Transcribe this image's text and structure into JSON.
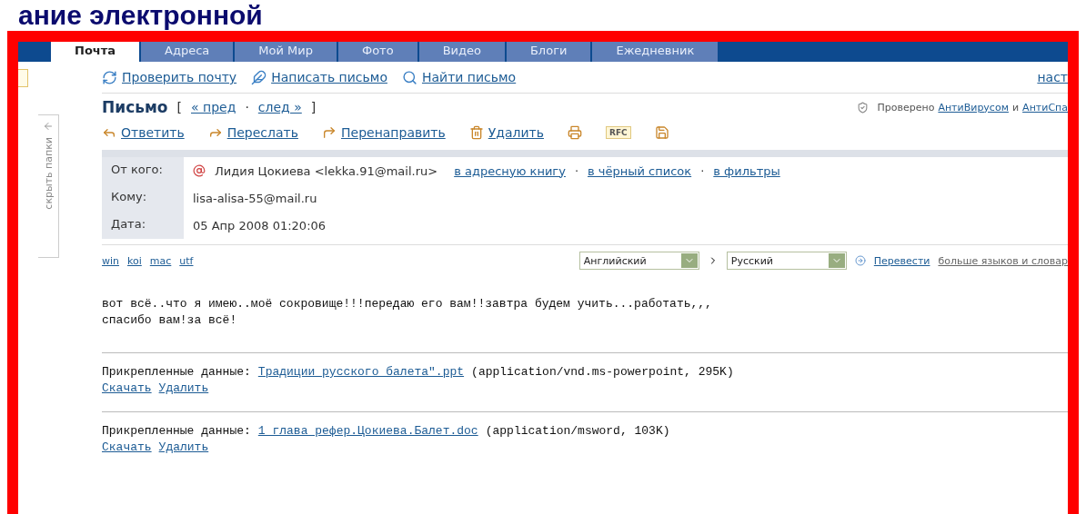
{
  "slide_title": "ание электронной",
  "tabs": [
    {
      "label": "Почта",
      "selected": true
    },
    {
      "label": "Адреса",
      "selected": false
    },
    {
      "label": "Мой Мир",
      "selected": false
    },
    {
      "label": "Фото",
      "selected": false
    },
    {
      "label": "Видео",
      "selected": false
    },
    {
      "label": "Блоги",
      "selected": false
    },
    {
      "label": "Ежедневник",
      "selected": false
    }
  ],
  "sidebar": {
    "toggle": "скрыть папки"
  },
  "toolbar": {
    "items": [
      {
        "kind": "check",
        "label": "Проверить почту"
      },
      {
        "kind": "compose",
        "label": "Написать письмо"
      },
      {
        "kind": "find",
        "label": "Найти письмо"
      }
    ],
    "settings_link": "наст"
  },
  "letter": {
    "title": "Письмо",
    "bracket_open": "[",
    "prev": "« пред",
    "separator": "·",
    "next": "след »",
    "bracket_close": "]",
    "scan_note": {
      "text": "Проверено",
      "antivirus": "АнтиВирусом",
      "and": "и",
      "antispam": "АнтиСпа"
    }
  },
  "actions": [
    {
      "kind": "reply",
      "label": "Ответить"
    },
    {
      "kind": "forward",
      "label": "Переслать"
    },
    {
      "kind": "redirect",
      "label": "Перенаправить"
    },
    {
      "kind": "delete",
      "label": "Удалить"
    },
    {
      "kind": "print"
    },
    {
      "kind": "rfc",
      "label": "RFC"
    },
    {
      "kind": "save"
    }
  ],
  "headers": [
    {
      "kind": "from",
      "label": "От кого:",
      "value": "Лидия Цокиева <lekka.91@mail.ru>",
      "links": [
        "в адресную книгу",
        "в чёрный список",
        "в фильтры"
      ],
      "separator": "·"
    },
    {
      "kind": "plain",
      "label": "Кому:",
      "value": "lisa-alisa-55@mail.ru"
    },
    {
      "kind": "plain",
      "label": "Дата:",
      "value": "05 Апр 2008 01:20:06"
    }
  ],
  "encodings": [
    "win",
    "koi",
    "mac",
    "utf"
  ],
  "translate": {
    "source": "Английский",
    "target": "Русский",
    "button": "Перевести",
    "more": "больше языков и словар"
  },
  "body": [
    "вот всё..что я имею..моё сокровище!!!передаю его вам!!завтра будем учить...работать,,,",
    "спасибо вам!за всё!"
  ],
  "attachments": [
    {
      "label": "Прикрепленные данные:",
      "file": "Традиции русского балета\".ppt",
      "info": "(application/vnd.ms-powerpoint, 295K)",
      "download": "Скачать",
      "delete": "Удалить"
    },
    {
      "label": "Прикрепленные данные:",
      "file": "1 глава рефер.Цокиева.Балет.doc",
      "info": "(application/msword, 103K)",
      "download": "Скачать",
      "delete": "Удалить"
    }
  ]
}
